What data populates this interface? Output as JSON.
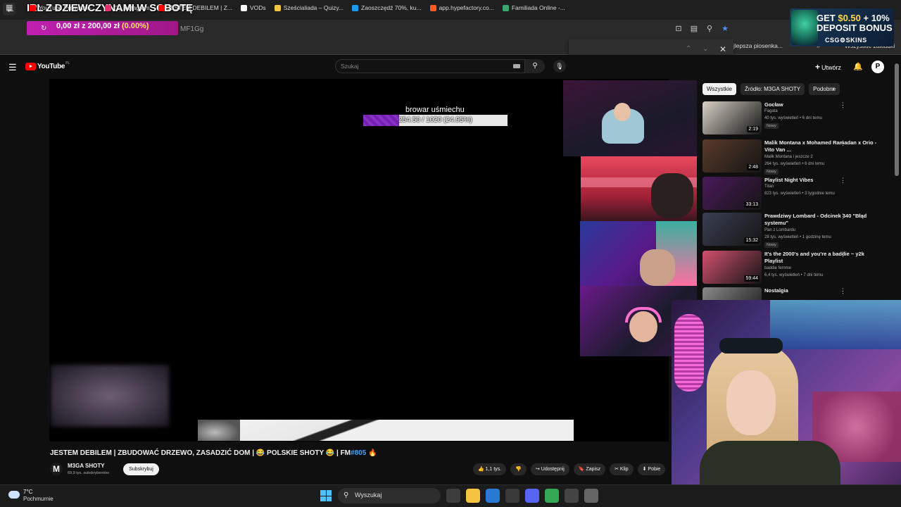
{
  "browser": {
    "stream_title": "IRL Z DZIEWCZYNAMI W SOBOTĘ",
    "donation": {
      "amount": "0,00 zł",
      "separator": "z",
      "goal": "200,00 zł",
      "percent": "(0.00%)"
    },
    "url_fragment": "MF1Gg",
    "bookmarks": [
      {
        "label": "YouTube Premium -...",
        "color": "#ff0000"
      },
      {
        "label": "(2) Instagram",
        "color": "#e1306c"
      },
      {
        "label": "JESTEM DEBILEM | Z...",
        "color": "#ff0000"
      },
      {
        "label": "VODs",
        "color": "#ffffff"
      },
      {
        "label": "Sześcialiada – Quizy...",
        "color": "#f5c542"
      },
      {
        "label": "Zaoszczędź 70%, ku...",
        "color": "#1b9aee"
      },
      {
        "label": "app.hypefactory.co...",
        "color": "#ff5a1f"
      },
      {
        "label": "Familiada Online -...",
        "color": "#3aa76d"
      }
    ],
    "bookmark_right": "jlepsza piosenka...",
    "bookmark_all": "Wszystkie zakładki"
  },
  "promo": {
    "line1_prefix": "GET ",
    "line1_amount": "$0.50",
    "line1_suffix": " + 10%",
    "line2": "DEPOSIT BONUS",
    "brand": "CSG⚙SKINS"
  },
  "youtube": {
    "logo": "YouTube",
    "country": "PL",
    "search_placeholder": "Szukaj",
    "create_label": "Utwórz",
    "avatar_letter": "P"
  },
  "overlay": {
    "goal_label": "browar uśmiechu",
    "goal_text": "254.50 / 1020 (24.95%)",
    "goal_fraction": 0.2495
  },
  "sidebar": {
    "chips": [
      "Wszystkie",
      "Źródło: M3GA SHOTY",
      "Podobne"
    ],
    "items": [
      {
        "title": "Gocław",
        "channel": "Fagata",
        "meta": "40 tys. wyświetleń • 6 dni temu",
        "badge": "Nowy",
        "duration": "2:19",
        "thumb": "#d9d2c7"
      },
      {
        "title": "Malik Montana x Mohamed Ramadan x Orio - Vito Van ...",
        "channel": "Malik Montana i jeszcze 2",
        "meta": "264 tys. wyświetleń • 6 dni temu",
        "badge": "Nowy",
        "duration": "2:48",
        "thumb": "#5a3a2a"
      },
      {
        "title": "Playlist Night Vibes",
        "channel": "Titan",
        "meta": "823 tys. wyświetleń • 3 tygodnie temu",
        "badge": "",
        "duration": "33:13",
        "thumb": "#4a1a5a"
      },
      {
        "title": "Prawdziwy Lombard - Odcinek 340 \"Błąd systemu\"",
        "channel": "Pan z Lombardu",
        "meta": "28 tys. wyświetleń • 1 godzinę temu",
        "badge": "Nowy",
        "duration": "15:32",
        "thumb": "#3a3f52"
      },
      {
        "title": "It's the 2000's and you're a baddie ~ y2k Playlist",
        "channel": "baddie femme",
        "meta": "6,4 tys. wyświetleń • 7 dni temu",
        "badge": "",
        "duration": "59:44",
        "thumb": "#d2506e"
      },
      {
        "title": "Nostalgia",
        "channel": "",
        "meta": "",
        "badge": "",
        "duration": "",
        "thumb": "#8a8a8a"
      }
    ]
  },
  "video": {
    "title": "JESTEM DEBILEM | ZBUDOWAĆ DRZEWO, ZASADZIĆ DOM | 😂 POLSKIE SHOTY 😂 | FM",
    "tag": "#805",
    "title_end": " 🔥",
    "channel": "M3GA SHOTY",
    "channel_initial": "M",
    "subscribers": "69,9 tys. subskrybentów",
    "subscribe": "Subskrybuj",
    "actions": [
      "👍 1,1 tys.",
      "👎",
      "↪ Udostępnij",
      "🔖 Zapisz",
      "✂ Klip",
      "⬇ Pobie"
    ]
  },
  "taskbar": {
    "temperature": "7°C",
    "weather": "Pochmurnie",
    "search": "Wyszukaj",
    "apps": [
      "#3c3c3c",
      "#f5c542",
      "#2a7ad5",
      "#3a3a3a",
      "#5865f2",
      "#34a853",
      "#444444",
      "#666666"
    ]
  }
}
